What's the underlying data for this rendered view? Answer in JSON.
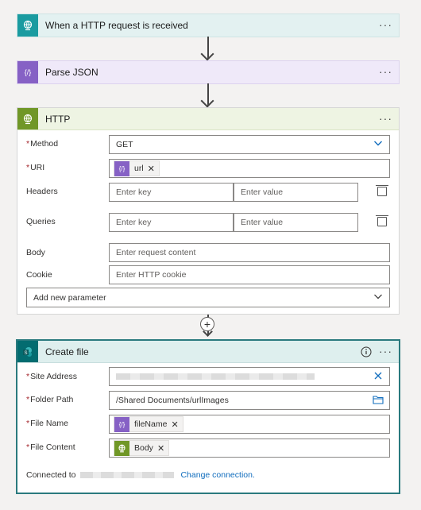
{
  "steps": {
    "trigger": {
      "title": "When a HTTP request is received",
      "icon": "globe-icon",
      "color": "#1a9ba0"
    },
    "parse": {
      "title": "Parse JSON",
      "icon": "{/}",
      "color": "#8661c5"
    },
    "http": {
      "title": "HTTP",
      "icon": "globe-icon",
      "color": "#709727",
      "method_label": "Method",
      "method_value": "GET",
      "uri_label": "URI",
      "uri_token": "url",
      "headers_label": "Headers",
      "headers_key_ph": "Enter key",
      "headers_value_ph": "Enter value",
      "queries_label": "Queries",
      "queries_key_ph": "Enter key",
      "queries_value_ph": "Enter value",
      "body_label": "Body",
      "body_ph": "Enter request content",
      "cookie_label": "Cookie",
      "cookie_ph": "Enter HTTP cookie",
      "add_param": "Add new parameter"
    },
    "create": {
      "title": "Create file",
      "icon": "sharepoint-icon",
      "color": "#036c70",
      "site_label": "Site Address",
      "folder_label": "Folder Path",
      "folder_value": "/Shared Documents/urlImages",
      "filename_label": "File Name",
      "filename_token": "fileName",
      "content_label": "File Content",
      "content_token": "Body",
      "connected_label": "Connected to",
      "change_connection": "Change connection."
    }
  },
  "more": "···",
  "required_mark": "*"
}
